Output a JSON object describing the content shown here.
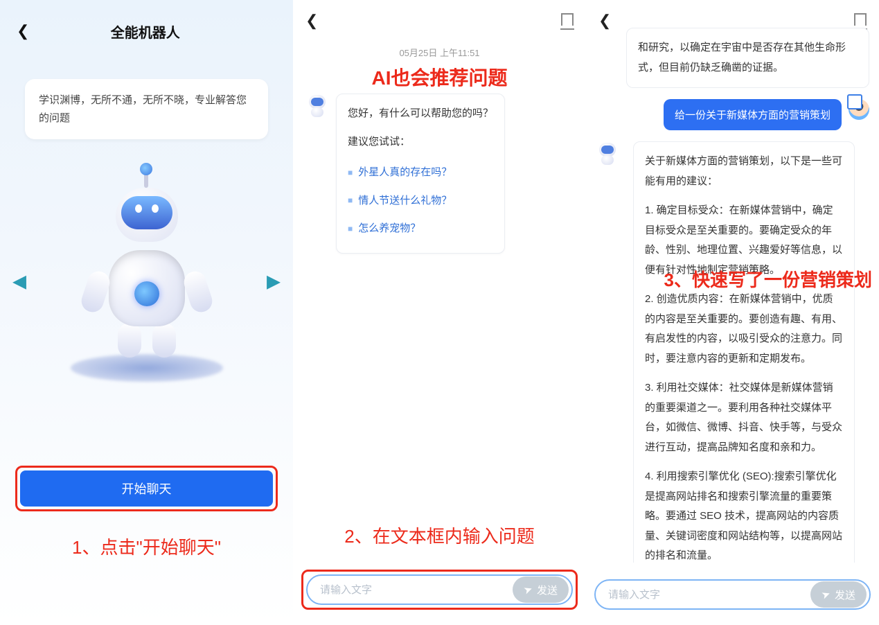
{
  "panel1": {
    "title": "全能机器人",
    "card_text": "学识渊博，无所不通，无所不晓，专业解答您的问题",
    "start_button": "开始聊天",
    "caption": "1、点击\"开始聊天\""
  },
  "panel2": {
    "timestamp": "05月25日  上午11:51",
    "red_title": "AI也会推荐问题",
    "greeting": "您好，有什么可以帮助您的吗？",
    "suggest_title": "建议您试试：",
    "suggestions": [
      "外星人真的存在吗？",
      "情人节送什么礼物？",
      "怎么养宠物？"
    ],
    "caption": "2、在文本框内输入问题",
    "input_placeholder": "请输入文字",
    "send_label": "发送"
  },
  "panel3": {
    "ai_prev_fragment": "和研究，以确定在宇宙中是否存在其他生命形式，但目前仍缺乏确凿的证据。",
    "user_msg": "给一份关于新媒体方面的营销策划",
    "ai_intro": "关于新媒体方面的营销策划，以下是一些可能有用的建议：",
    "ai_points": [
      "1. 确定目标受众：在新媒体营销中，确定目标受众是至关重要的。要确定受众的年龄、性别、地理位置、兴趣爱好等信息，以便有针对性地制定营销策略。",
      "2. 创造优质内容：在新媒体营销中，优质的内容是至关重要的。要创造有趣、有用、有启发性的内容，以吸引受众的注意力。同时，要注意内容的更新和定期发布。",
      "3. 利用社交媒体：社交媒体是新媒体营销的重要渠道之一。要利用各种社交媒体平台，如微信、微博、抖音、快手等，与受众进行互动，提高品牌知名度和亲和力。",
      "4. 利用搜索引擎优化 (SEO):搜索引擎优化是提高网站排名和搜索引擎流量的重要策略。要通过 SEO 技术，提高网站的内容质量、关键词密度和网站结构等，以提高网站的排名和流量。"
    ],
    "red_caption": "3、快速写了一份营销策划",
    "input_placeholder": "请输入文字",
    "send_label": "发送"
  }
}
